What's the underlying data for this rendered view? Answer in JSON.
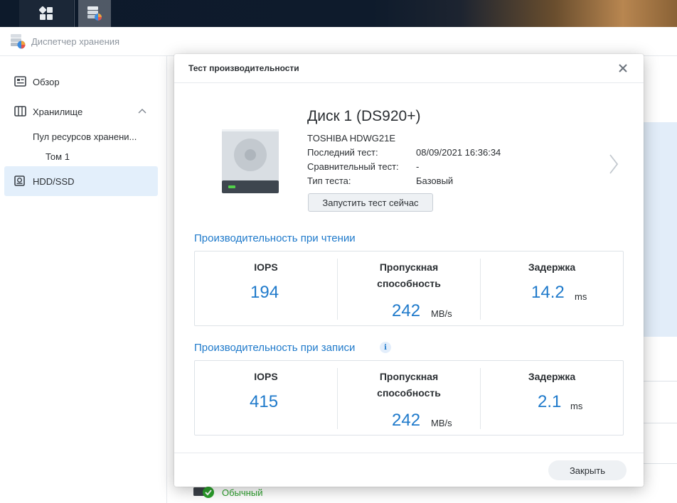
{
  "taskbar": {
    "apps_icon": "grid-icon",
    "storage_icon": "storage-manager-icon"
  },
  "app": {
    "title": "Диспетчер хранения"
  },
  "sidebar": {
    "overview": "Обзор",
    "storage": "Хранилище",
    "pool": "Пул ресурсов хранени...",
    "volume": "Том 1",
    "hdd": "HDD/SSD"
  },
  "background": {
    "status": "Обычный"
  },
  "modal": {
    "title": "Тест производительности",
    "disk": {
      "name": "Диск 1 (DS920+)",
      "model": "TOSHIBA HDWG21E",
      "last_test_label": "Последний тест:",
      "last_test_value": "08/09/2021 16:36:34",
      "compare_label": "Сравнительный тест:",
      "compare_value": "-",
      "type_label": "Тип теста:",
      "type_value": "Базовый"
    },
    "run_button": "Запустить тест сейчас",
    "read": {
      "title": "Производительность при чтении",
      "iops_label": "IOPS",
      "iops_value": "194",
      "throughput_label_1": "Пропускная",
      "throughput_label_2": "способность",
      "throughput_value": "242",
      "throughput_unit": "MB/s",
      "latency_label": "Задержка",
      "latency_value": "14.2",
      "latency_unit": "ms"
    },
    "write": {
      "title": "Производительность при записи",
      "iops_label": "IOPS",
      "iops_value": "415",
      "throughput_label_1": "Пропускная",
      "throughput_label_2": "способность",
      "throughput_value": "242",
      "throughput_unit": "MB/s",
      "latency_label": "Задержка",
      "latency_value": "2.1",
      "latency_unit": "ms"
    },
    "close_button": "Закрыть"
  },
  "colors": {
    "accent": "#1f7acb",
    "selected_nav": "#e3effb",
    "status_ok": "#2ca02c"
  }
}
